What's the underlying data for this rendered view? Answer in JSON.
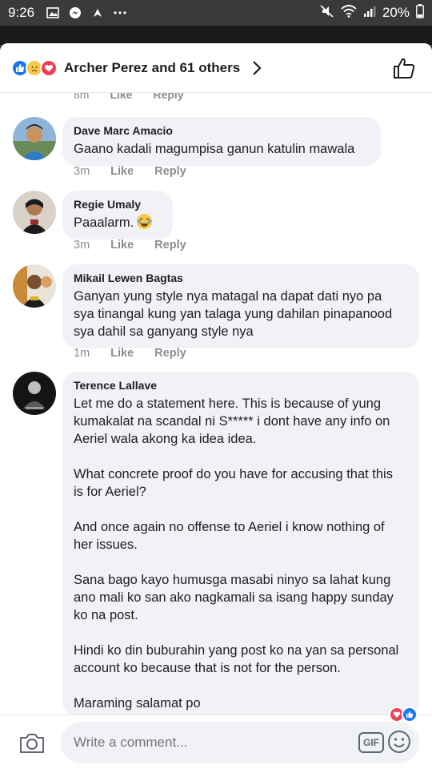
{
  "status_bar": {
    "time": "9:26",
    "battery": "20%",
    "icons_left": [
      "image-icon",
      "messenger-icon",
      "notification-icon",
      "more-dots-icon"
    ],
    "icons_right": [
      "mute-icon",
      "wifi-icon",
      "signal-icon"
    ]
  },
  "header": {
    "reactions": [
      "like",
      "sad",
      "love"
    ],
    "reactor_text": "Archer Perez and 61 others"
  },
  "cut_meta": {
    "time": "8m",
    "like": "Like",
    "reply": "Reply"
  },
  "comments": [
    {
      "author": "Dave Marc Amacio",
      "text": "Gaano kadali magumpisa ganun katulin mawala",
      "time": "3m",
      "like": "Like",
      "reply": "Reply"
    },
    {
      "author": "Regie Umaly",
      "text": "Paaalarm.",
      "time": "3m",
      "like": "Like",
      "reply": "Reply"
    },
    {
      "author": "Mikail Lewen Bagtas",
      "text": "Ganyan yung style nya matagal na dapat dati nyo pa\nsya tinangal kung yan talaga yung dahilan pinapanood\nsya dahil sa ganyang style nya",
      "time": "1m",
      "like": "Like",
      "reply": "Reply"
    },
    {
      "author": "Terence Lallave",
      "text": "Let me do a statement here. This is because of yung\nkumakalat na scandal ni S***** i dont have any info on\nAeriel wala akong ka idea idea.\n\nWhat concrete proof do you have for accusing that this\nis for Aeriel?\n\nAnd once again no offense to Aeriel i know nothing of\nher issues.\n\nSana bago kayo humusga masabi ninyo sa lahat kung\nano mali ko san ako nagkamali sa isang happy sunday\nko na post.\n\nHindi ko din buburahin yang post ko na yan sa personal\naccount ko because that is not for the person.\n\nMaraming salamat po"
    }
  ],
  "composer": {
    "placeholder": "Write a comment...",
    "gif_label": "GIF"
  },
  "colors": {
    "accent": "#1877f2",
    "bubble": "#f0f2f5",
    "love": "#f33e58"
  }
}
